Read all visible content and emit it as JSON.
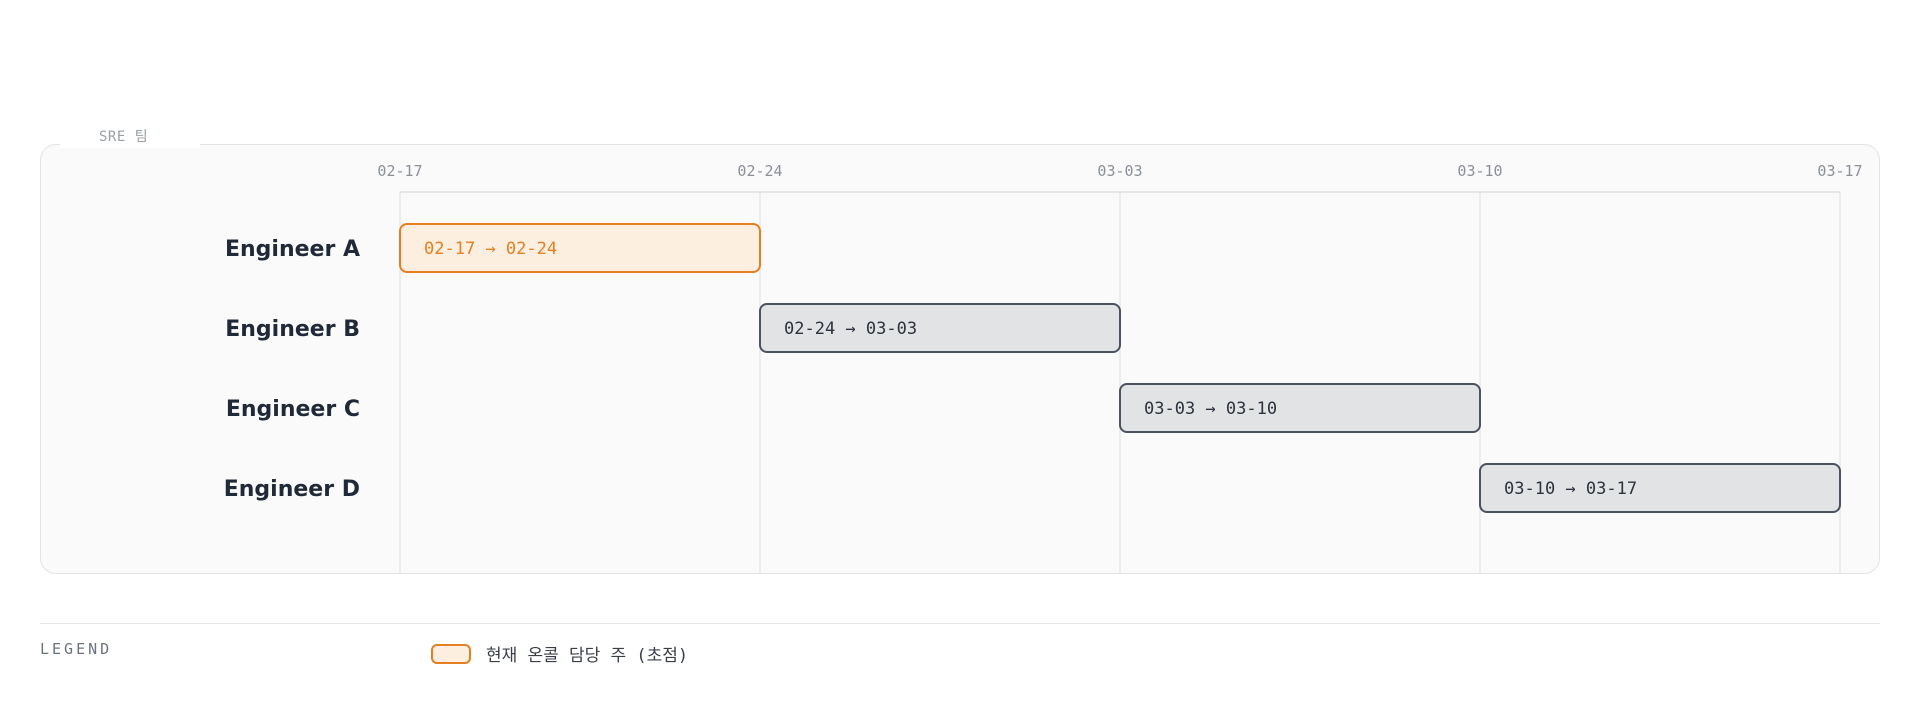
{
  "chart_data": {
    "type": "gantt",
    "group_label": "SRE 팀",
    "x": [
      "02-17",
      "02-24",
      "03-03",
      "03-10",
      "03-17"
    ],
    "rows": [
      {
        "name": "Engineer A",
        "start": "02-17",
        "end": "02-24",
        "label": "02-17 → 02-24",
        "focus": true
      },
      {
        "name": "Engineer B",
        "start": "02-24",
        "end": "03-03",
        "label": "02-24 → 03-03",
        "focus": false
      },
      {
        "name": "Engineer C",
        "start": "03-03",
        "end": "03-10",
        "label": "03-03 → 03-10",
        "focus": false
      },
      {
        "name": "Engineer D",
        "start": "03-10",
        "end": "03-17",
        "label": "03-10 → 03-17",
        "focus": false
      }
    ],
    "legend": {
      "title": "LEGEND",
      "items": [
        {
          "label": "현재 온콜 담당 주 (초점)",
          "style": "focus"
        }
      ]
    },
    "colors": {
      "focus_fill": "#fdefdf",
      "focus_stroke": "#e67e22",
      "focus_text": "#e67e22",
      "bar_fill": "#e2e3e5",
      "bar_stroke": "#4b5260",
      "bar_text": "#2d333d",
      "grid": "#e0e0e0",
      "row_label": "#1f2937",
      "tick_label": "#8a8f98"
    }
  }
}
